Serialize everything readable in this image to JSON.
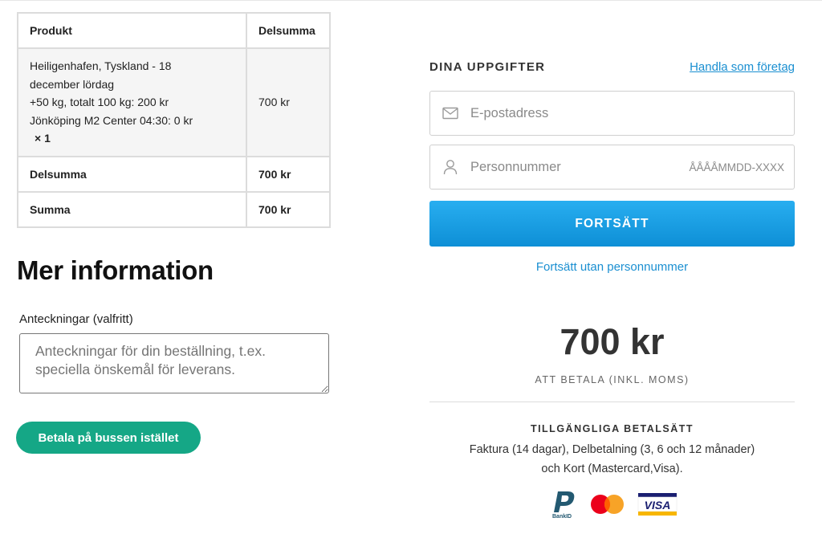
{
  "order": {
    "headers": {
      "product": "Produkt",
      "subtotal": "Delsumma"
    },
    "item": {
      "line1": "Heiligenhafen, Tyskland - 18",
      "line2": "december lördag",
      "line3": "+50 kg, totalt 100 kg: 200 kr",
      "line4": "Jönköping M2 Center 04:30: 0 kr",
      "qty": "× 1",
      "price": "700 kr"
    },
    "subtotal_label": "Delsumma",
    "subtotal_value": "700 kr",
    "total_label": "Summa",
    "total_value": "700 kr"
  },
  "more_info": {
    "title": "Mer information",
    "notes_label": "Anteckningar (valfritt)",
    "notes_placeholder": "Anteckningar för din beställning, t.ex. speciella önskemål för leverans.",
    "bus_button": "Betala på bussen istället"
  },
  "details": {
    "title": "DINA UPPGIFTER",
    "company_link": "Handla som företag",
    "email_placeholder": "E-postadress",
    "pnr_placeholder": "Personnummer",
    "pnr_hint": "ÅÅÅÅMMDD-XXXX",
    "continue_button": "FORTSÄTT",
    "continue_without": "Fortsätt utan personnummer"
  },
  "payment": {
    "amount": "700 kr",
    "amount_label": "ATT BETALA (INKL. MOMS)",
    "methods_title": "TILLGÄNGLIGA BETALSÄTT",
    "methods_text": "Faktura (14 dagar), Delbetalning (3, 6 och 12 månader) och Kort (Mastercard,Visa).",
    "logos": [
      "bankid-icon",
      "mastercard-icon",
      "visa-icon"
    ],
    "bankid_text": "BankID",
    "visa_text": "VISA"
  },
  "colors": {
    "accent": "#1a8fd1",
    "button_blue": "#1aa0e6",
    "button_green": "#15a786",
    "mastercard_red": "#eb001b",
    "mastercard_orange": "#f79e1b",
    "visa_blue": "#1a1f71",
    "visa_gold": "#f7b600"
  }
}
